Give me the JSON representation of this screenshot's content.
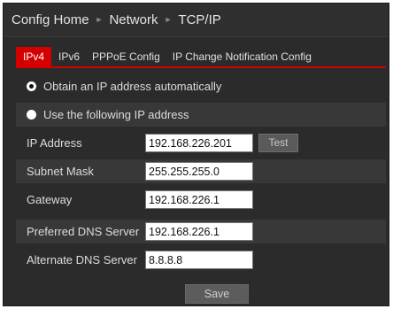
{
  "breadcrumb": {
    "items": [
      "Config Home",
      "Network",
      "TCP/IP"
    ],
    "separator": "►"
  },
  "tabs": [
    {
      "label": "IPv4",
      "active": true
    },
    {
      "label": "IPv6",
      "active": false
    },
    {
      "label": "PPPoE Config",
      "active": false
    },
    {
      "label": "IP Change Notification Config",
      "active": false
    }
  ],
  "ip_mode": {
    "auto_label": "Obtain an IP address automatically",
    "manual_label": "Use the following IP address",
    "selected": "auto"
  },
  "fields": {
    "ip_address": {
      "label": "IP Address",
      "value": "192.168.226.201"
    },
    "subnet_mask": {
      "label": "Subnet Mask",
      "value": "255.255.255.0"
    },
    "gateway": {
      "label": "Gateway",
      "value": "192.168.226.1"
    },
    "preferred_dns": {
      "label": "Preferred DNS Server",
      "value": "192.168.226.1"
    },
    "alternate_dns": {
      "label": "Alternate DNS Server",
      "value": "8.8.8.8"
    }
  },
  "buttons": {
    "test": "Test",
    "save": "Save"
  },
  "colors": {
    "accent": "#d40000",
    "background": "#2b2b2b"
  }
}
